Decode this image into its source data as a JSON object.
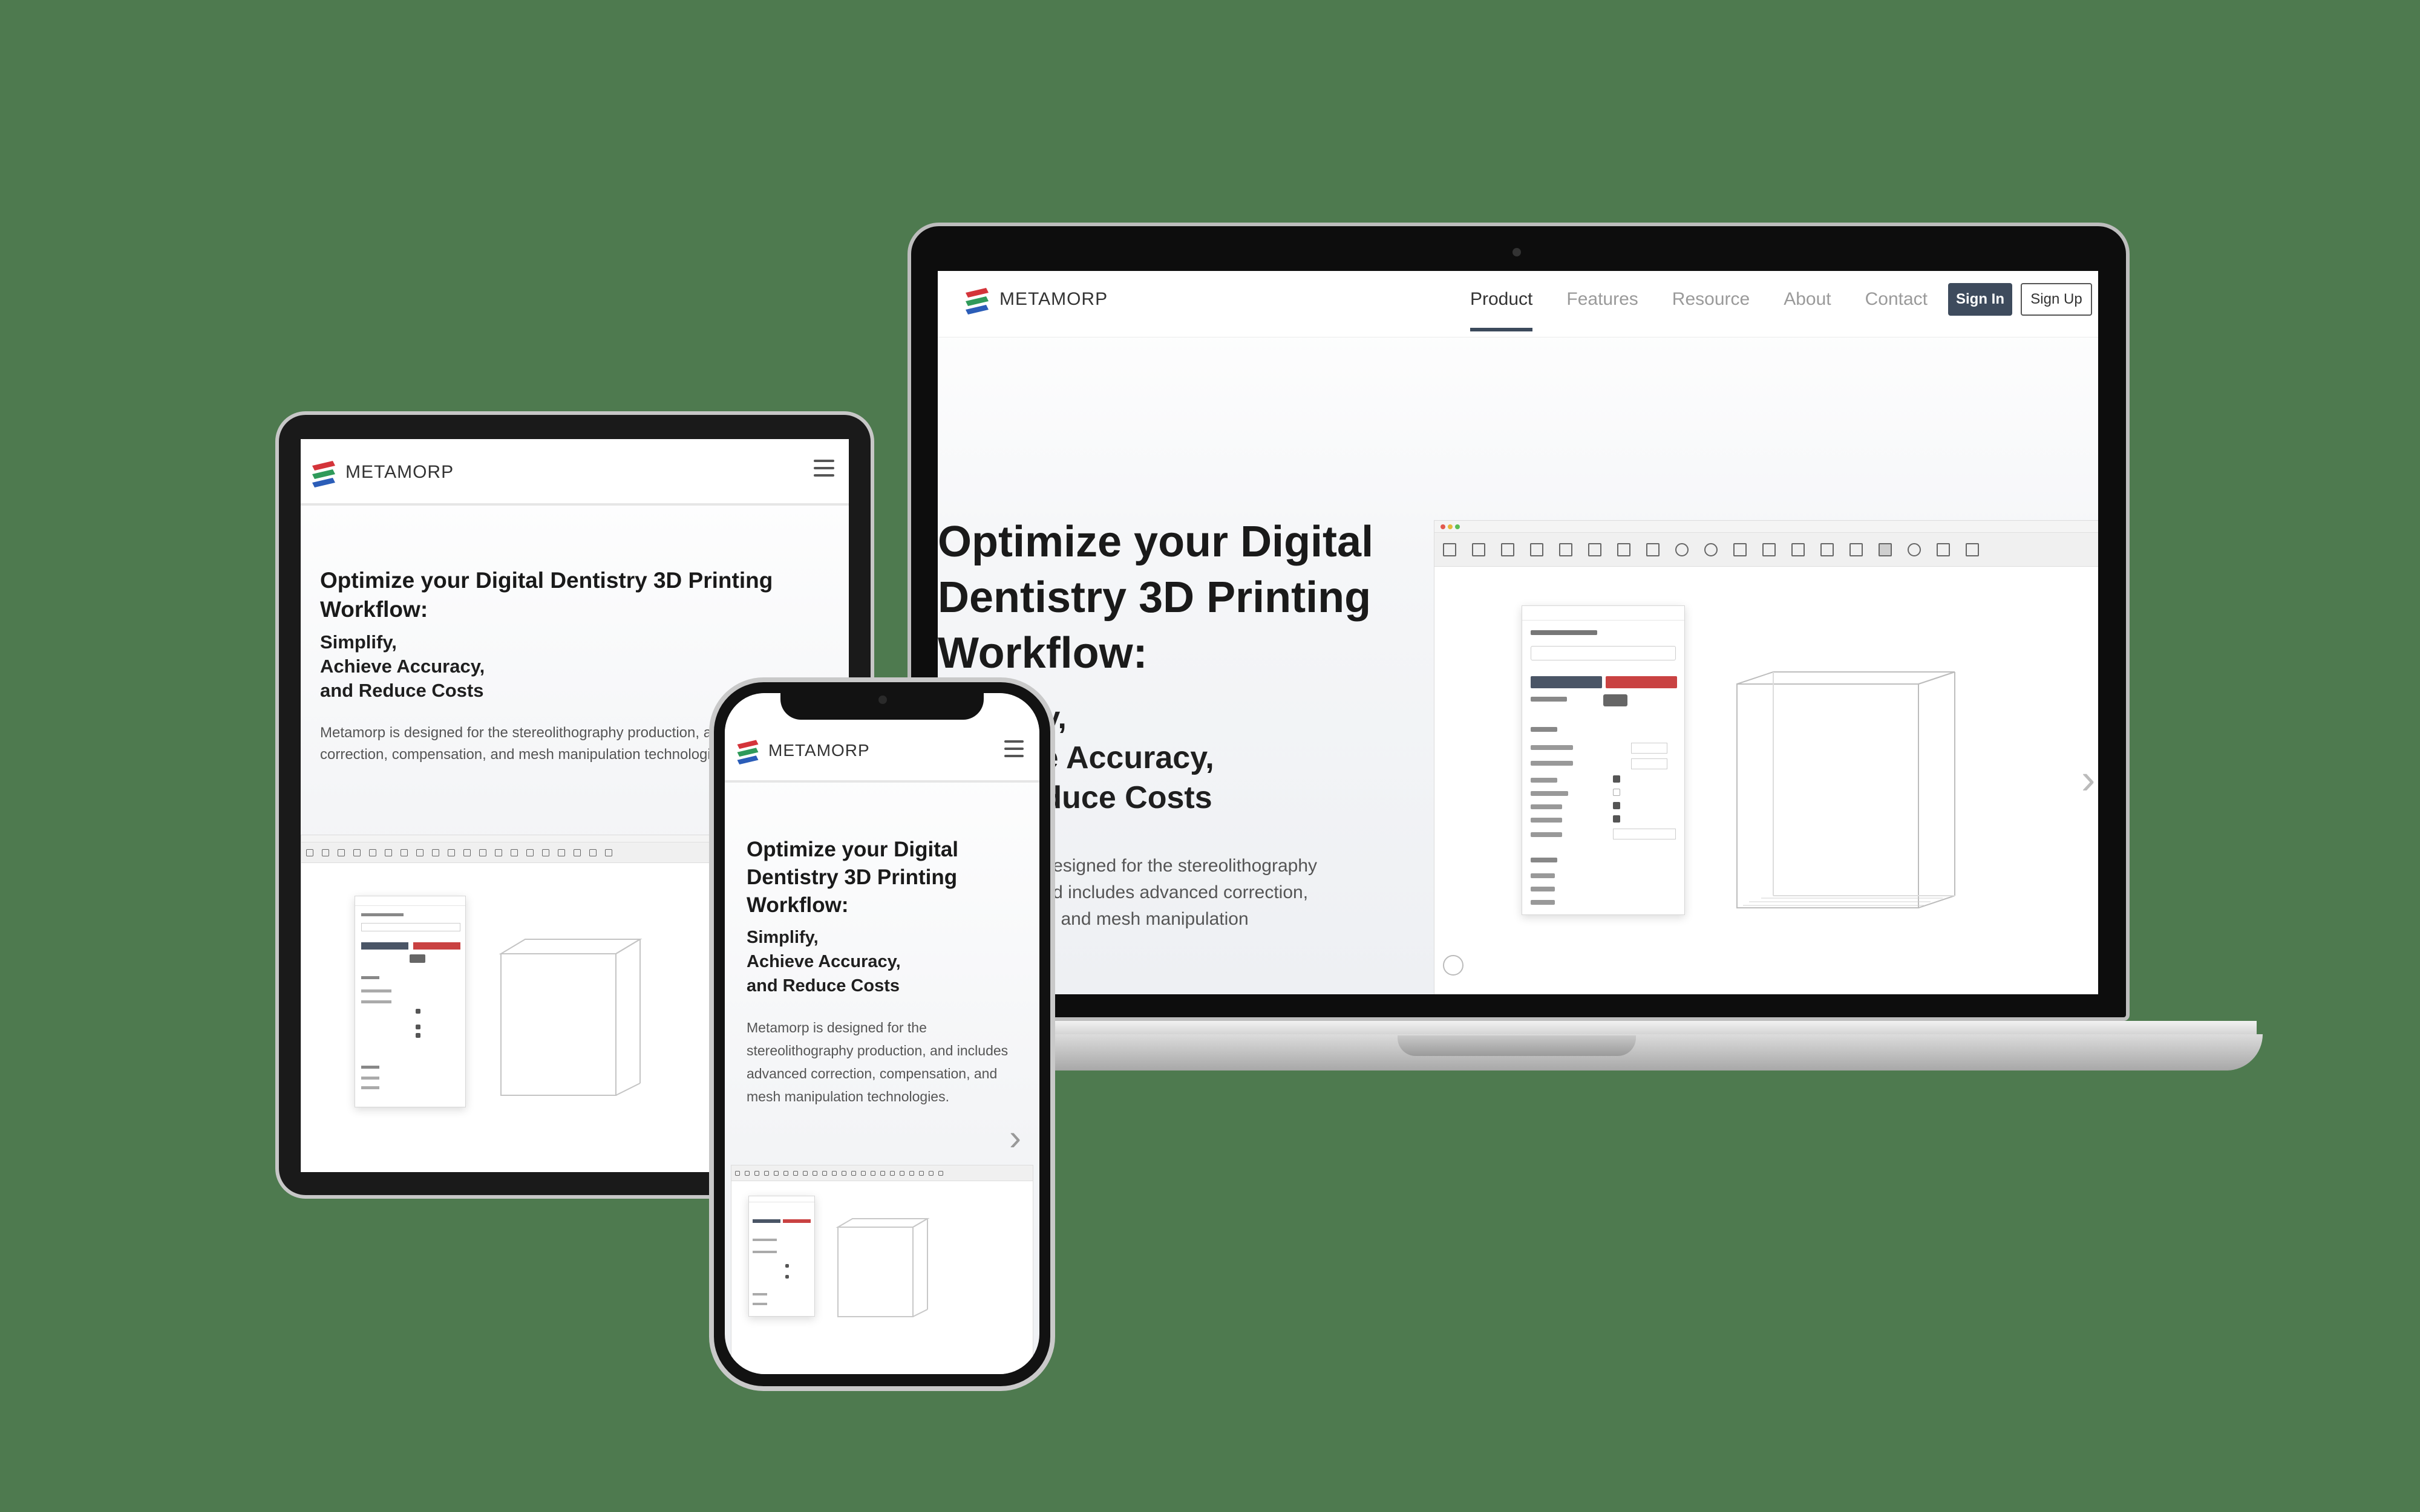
{
  "brand": {
    "name": "METAMORP"
  },
  "colors": {
    "background": "#4e7a4f",
    "nav_active": "#3e4b5d",
    "logo_red": "#d4343a",
    "logo_green": "#2f9a5a",
    "logo_blue": "#2b5db8",
    "app_red": "#c94242",
    "app_dark": "#4a5566"
  },
  "laptop": {
    "nav": {
      "links": [
        "Product",
        "Features",
        "Resource",
        "About",
        "Contact"
      ],
      "active": "Product",
      "signin_label": "Sign In",
      "signup_label": "Sign Up"
    },
    "hero": {
      "title": "Optimize your Digital Dentistry 3D Printing Workflow:",
      "sub": "Simplify,\nAchieve Accuracy,\nand Reduce Costs",
      "desc": "Metamorp is designed for the stereolithography production, and includes advanced correction, compensation, and mesh manipulation technologies."
    }
  },
  "tablet": {
    "hero": {
      "title": "Optimize your Digital Dentistry 3D Printing Workflow:",
      "sub": "Simplify,\nAchieve Accuracy,\nand Reduce Costs",
      "desc": "Metamorp is designed for the stereolithography production, and includes advanced correction, compensation, and mesh manipulation technologies."
    }
  },
  "phone": {
    "hero": {
      "title": "Optimize your Digital Dentistry 3D Printing Workflow:",
      "sub": "Simplify,\nAchieve Accuracy,\nand Reduce Costs",
      "desc": "Metamorp is designed for the stereolithography production, and includes advanced correction, compensation, and mesh manipulation technologies."
    }
  },
  "icons": {
    "menu": "hamburger-icon",
    "next": "chevron-right-icon"
  }
}
